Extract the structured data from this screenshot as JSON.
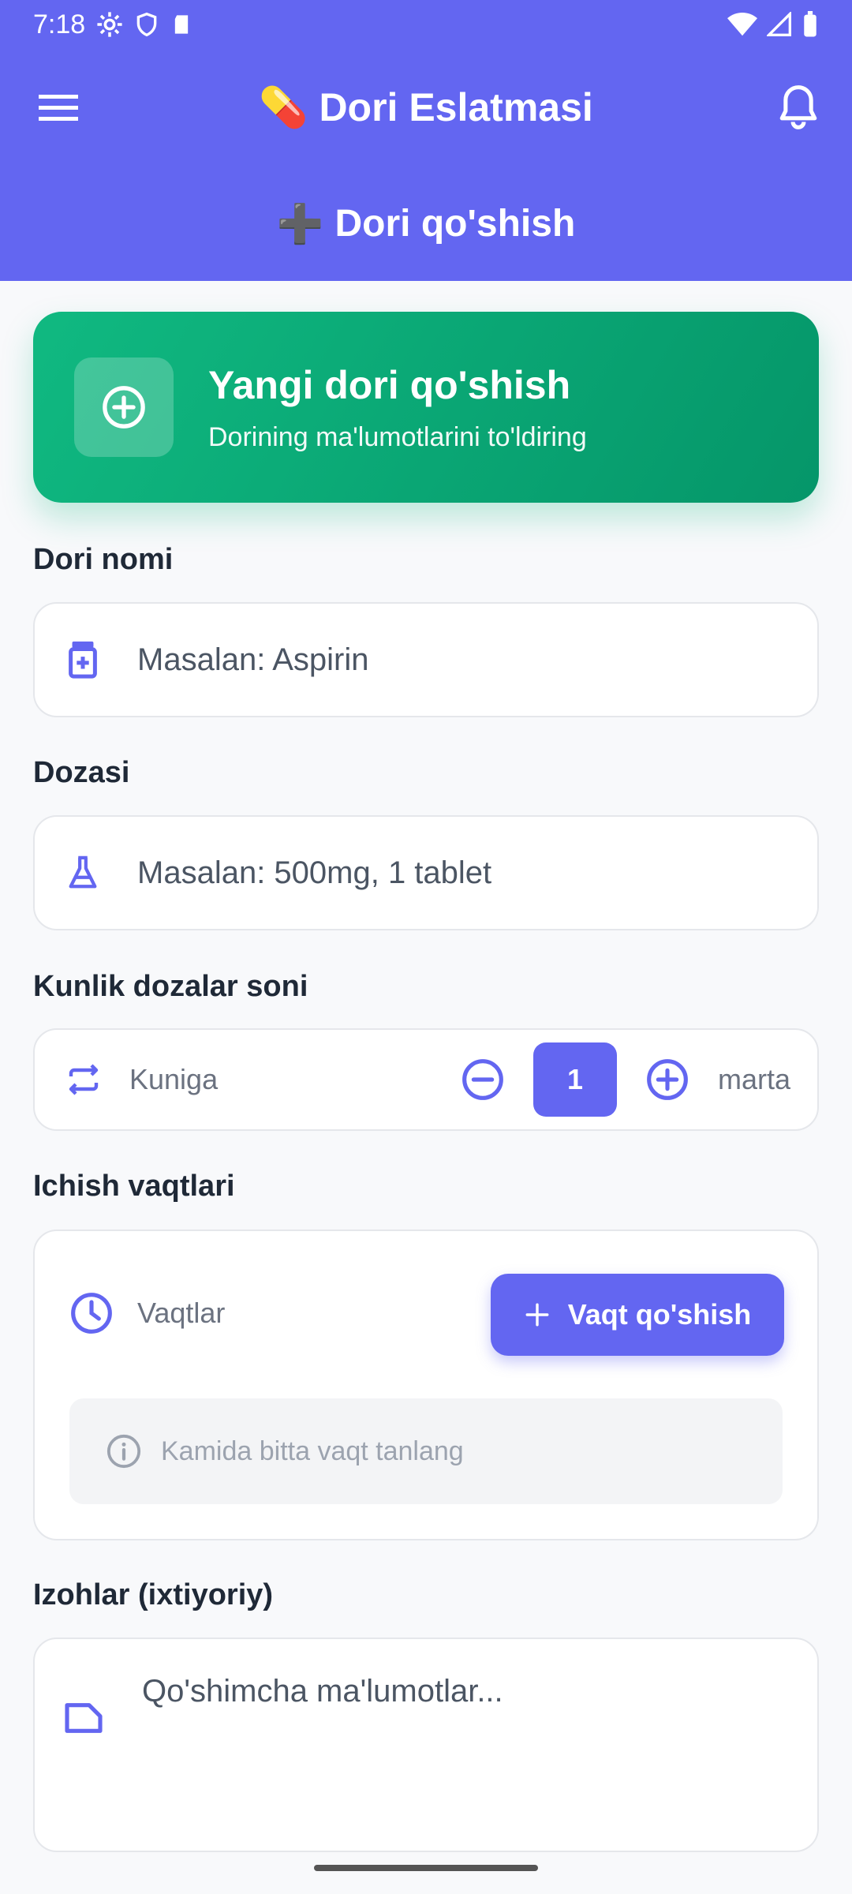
{
  "status_bar": {
    "time": "7:18"
  },
  "app_bar": {
    "title_emoji": "💊",
    "title": "Dori Eslatmasi"
  },
  "subheader": {
    "emoji": "➕",
    "title": "Dori qo'shish"
  },
  "hero": {
    "title": "Yangi dori qo'shish",
    "subtitle": "Dorining ma'lumotlarini to'ldiring"
  },
  "form": {
    "name": {
      "label": "Dori nomi",
      "placeholder": "Masalan: Aspirin"
    },
    "dose": {
      "label": "Dozasi",
      "placeholder": "Masalan: 500mg, 1 tablet"
    },
    "daily": {
      "label": "Kunlik dozalar soni",
      "prefix": "Kuniga",
      "count": "1",
      "suffix": "marta"
    },
    "times": {
      "label": "Ichish vaqtlari",
      "title": "Vaqtlar",
      "add_button": "Vaqt qo'shish",
      "hint": "Kamida bitta vaqt tanlang"
    },
    "notes": {
      "label": "Izohlar (ixtiyoriy)",
      "placeholder": "Qo'shimcha ma'lumotlar..."
    }
  },
  "colors": {
    "primary": "#6366f1",
    "success": "#10b981",
    "background": "#f8f9fb"
  }
}
